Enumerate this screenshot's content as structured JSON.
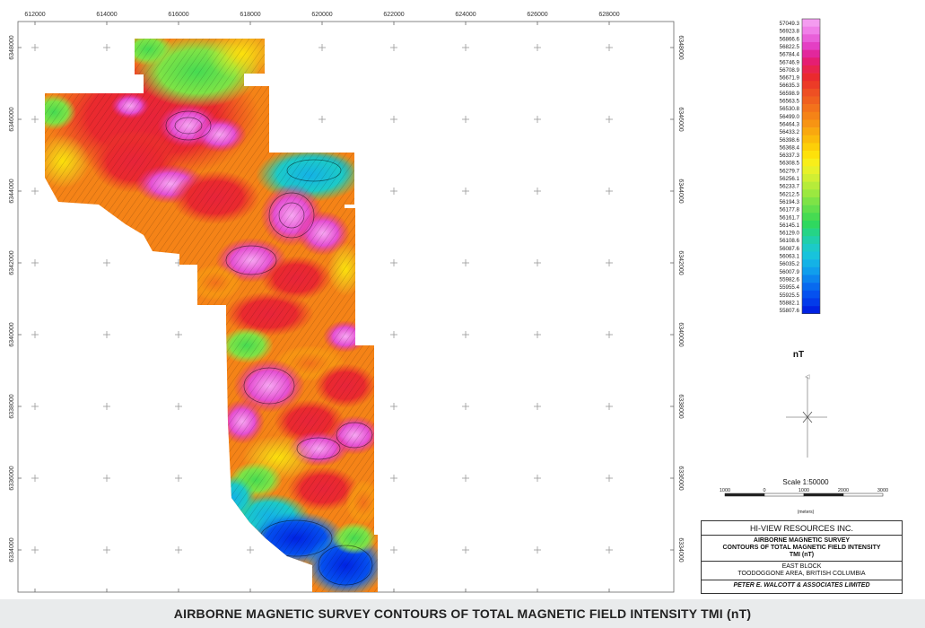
{
  "map": {
    "x_ticks": [
      "612000",
      "614000",
      "616000",
      "618000",
      "620000",
      "622000",
      "624000",
      "626000",
      "628000"
    ],
    "y_ticks": [
      "6348000",
      "6346000",
      "6344000",
      "6342000",
      "6340000",
      "6338000",
      "6336000",
      "6334000"
    ]
  },
  "legend": {
    "values": [
      "57049.3",
      "56923.8",
      "56866.6",
      "56822.5",
      "56784.4",
      "56746.9",
      "56708.9",
      "56671.9",
      "56635.3",
      "56598.9",
      "56563.5",
      "56530.8",
      "56499.0",
      "56464.3",
      "56433.2",
      "56398.6",
      "56368.4",
      "56337.3",
      "56308.5",
      "56279.7",
      "56256.1",
      "56233.7",
      "56212.5",
      "56194.3",
      "56177.8",
      "56161.7",
      "56145.1",
      "56129.0",
      "56108.6",
      "56087.6",
      "56063.1",
      "56035.2",
      "56007.9",
      "55982.6",
      "55955.4",
      "55925.5",
      "55882.1",
      "55807.6"
    ],
    "colors": [
      "#f49cf0",
      "#f07fe8",
      "#e95fd9",
      "#e43fc4",
      "#e2279c",
      "#e51e72",
      "#e8244d",
      "#ea2a2e",
      "#ec3b27",
      "#ee4f23",
      "#f0601f",
      "#f3721b",
      "#f58317",
      "#f79413",
      "#f9a80f",
      "#fbbb0b",
      "#fdcf08",
      "#fee10a",
      "#f8ee1a",
      "#e7f12a",
      "#d0ef33",
      "#b6ec3a",
      "#9be840",
      "#7ee346",
      "#62df4c",
      "#46db52",
      "#2fd85f",
      "#25d486",
      "#20cfaa",
      "#1ccac8",
      "#18c3dc",
      "#14b2e6",
      "#109eec",
      "#0c84ee",
      "#086aef",
      "#0551ef",
      "#033bea",
      "#0022e2"
    ],
    "unit": "nT"
  },
  "scale": {
    "title": "Scale 1:50000",
    "labels": [
      "1000",
      "0",
      "1000",
      "2000",
      "3000"
    ],
    "unit": "(meters)"
  },
  "title_block": {
    "company": "HI-VIEW RESOURCES INC.",
    "survey_line1": "AIRBORNE MAGNETIC SURVEY",
    "survey_line2": "CONTOURS OF TOTAL MAGNETIC FIELD INTENSITY",
    "survey_line3": "TMI (nT)",
    "area_line1": "EAST BLOCK",
    "area_line2": "TOODOGGONE AREA, BRITISH COLUMBIA",
    "firm": "PETER E. WALCOTT & ASSOCIATES LIMITED"
  },
  "caption": "AIRBORNE MAGNETIC SURVEY CONTOURS OF TOTAL MAGNETIC FIELD INTENSITY TMI (nT)"
}
